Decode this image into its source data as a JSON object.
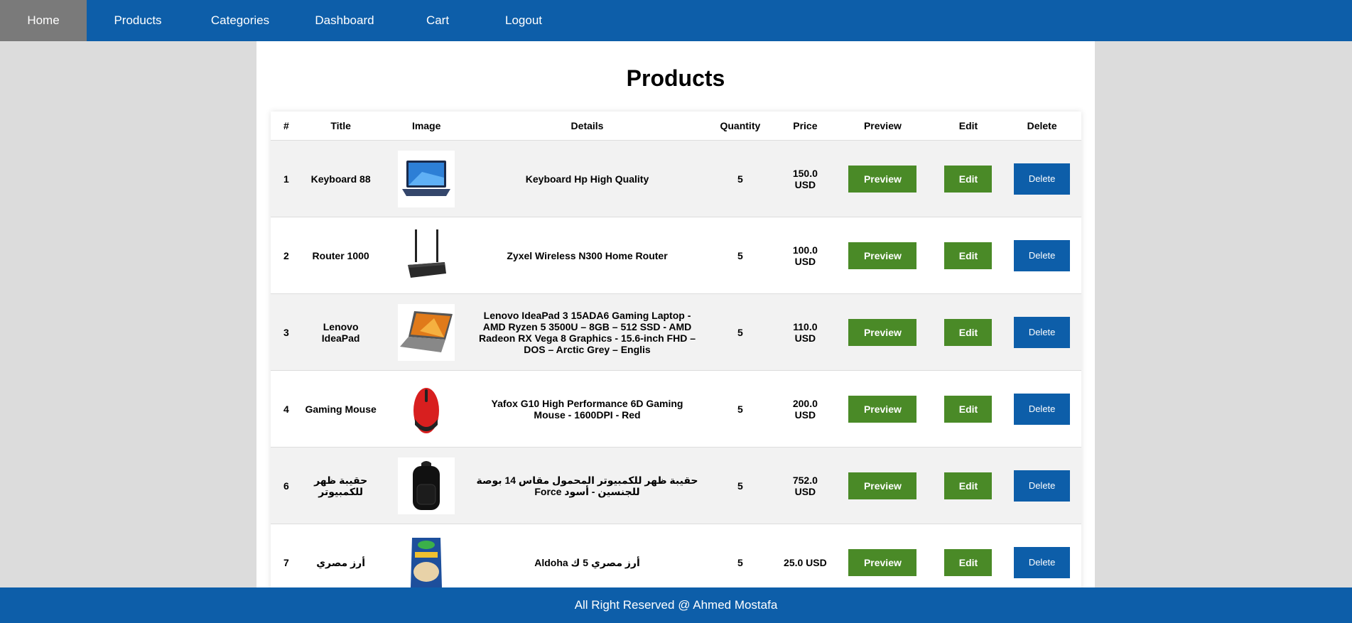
{
  "nav": {
    "items": [
      {
        "label": "Home",
        "active": true
      },
      {
        "label": "Products",
        "active": false
      },
      {
        "label": "Categories",
        "active": false
      },
      {
        "label": "Dashboard",
        "active": false
      },
      {
        "label": "Cart",
        "active": false
      },
      {
        "label": "Logout",
        "active": false
      }
    ]
  },
  "page": {
    "title": "Products"
  },
  "table": {
    "headers": [
      "#",
      "Title",
      "Image",
      "Details",
      "Quantity",
      "Price",
      "Preview",
      "Edit",
      "Delete"
    ],
    "rows": [
      {
        "id": "1",
        "title": "Keyboard 88",
        "image_icon": "laptop-icon",
        "details": "Keyboard Hp High Quality",
        "quantity": "5",
        "price": "150.0 USD",
        "preview": "Preview",
        "edit": "Edit",
        "delete": "Delete"
      },
      {
        "id": "2",
        "title": "Router 1000",
        "image_icon": "router-icon",
        "details": "Zyxel Wireless N300 Home Router",
        "quantity": "5",
        "price": "100.0 USD",
        "preview": "Preview",
        "edit": "Edit",
        "delete": "Delete"
      },
      {
        "id": "3",
        "title": "Lenovo IdeaPad",
        "image_icon": "laptop-icon",
        "details": "Lenovo IdeaPad 3 15ADA6 Gaming Laptop - AMD Ryzen 5 3500U – 8GB – 512 SSD - AMD Radeon RX Vega 8 Graphics - 15.6-inch FHD – DOS – Arctic Grey – Englis",
        "quantity": "5",
        "price": "110.0 USD",
        "preview": "Preview",
        "edit": "Edit",
        "delete": "Delete"
      },
      {
        "id": "4",
        "title": "Gaming Mouse",
        "image_icon": "mouse-icon",
        "details": "Yafox G10 High Performance 6D Gaming Mouse - 1600DPI - Red",
        "quantity": "5",
        "price": "200.0 USD",
        "preview": "Preview",
        "edit": "Edit",
        "delete": "Delete"
      },
      {
        "id": "6",
        "title": "حقيبة ظهر للكمبيوتر",
        "image_icon": "backpack-icon",
        "details": "حقيبة ظهر للكمبيوتر المحمول مقاس 14 بوصة للجنسين - أسود Force",
        "quantity": "5",
        "price": "752.0 USD",
        "preview": "Preview",
        "edit": "Edit",
        "delete": "Delete",
        "rtl": true
      },
      {
        "id": "7",
        "title": "أرز مصري",
        "image_icon": "rice-bag-icon",
        "details": "أرز مصري 5 ك Aldoha",
        "quantity": "5",
        "price": "25.0 USD",
        "preview": "Preview",
        "edit": "Edit",
        "delete": "Delete",
        "rtl": true
      }
    ]
  },
  "footer": {
    "text": "All Right Reserved @ Ahmed Mostafa"
  },
  "colors": {
    "primary": "#0d5ea9",
    "success": "#4a8a27",
    "active_nav": "#7a7a7a",
    "background": "#dcdcdc"
  }
}
